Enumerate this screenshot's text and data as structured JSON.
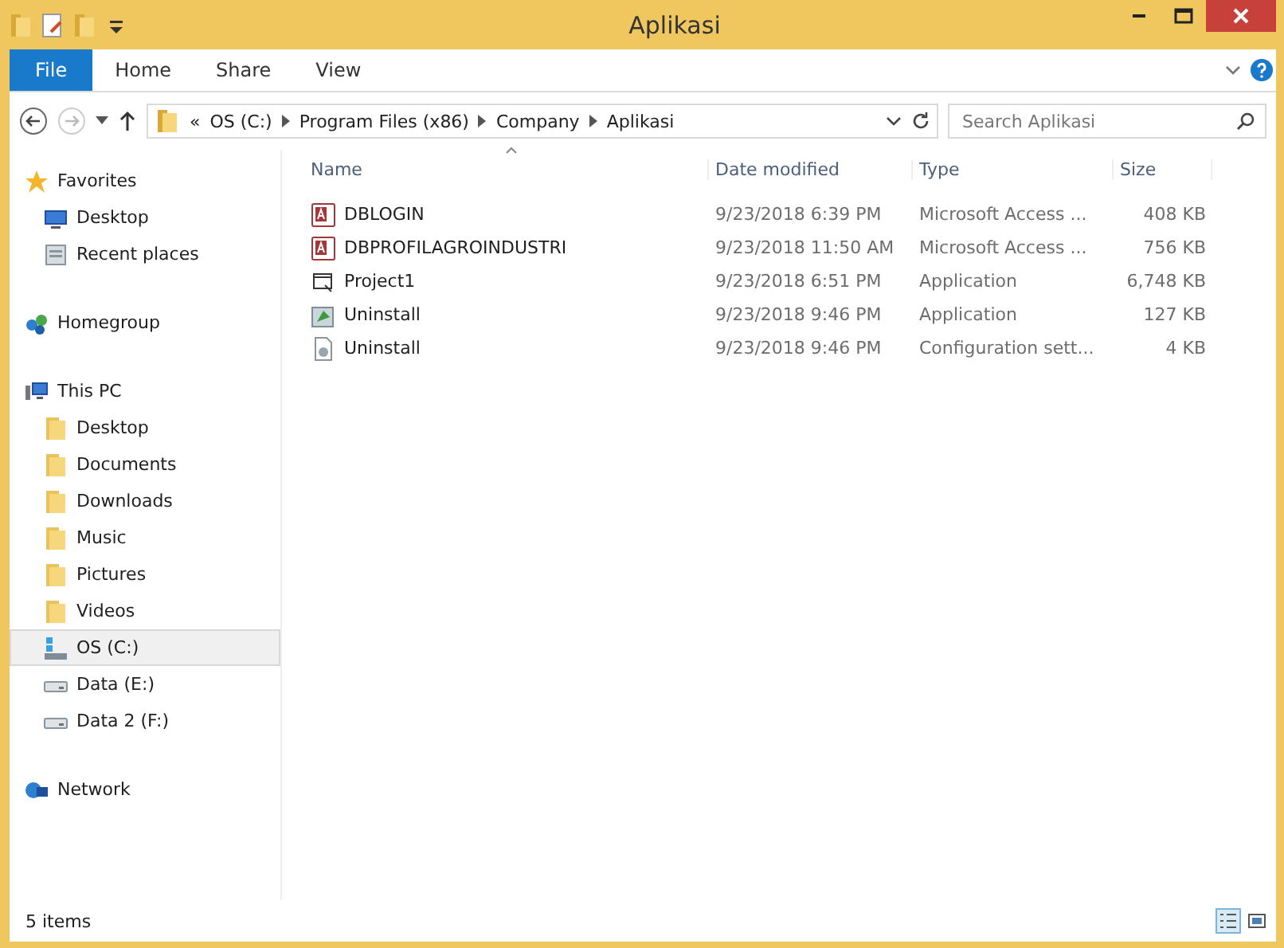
{
  "window": {
    "title": "Aplikasi"
  },
  "ribbon_tabs": [
    {
      "label": "File",
      "kind": "file"
    },
    {
      "label": "Home",
      "kind": "tab"
    },
    {
      "label": "Share",
      "kind": "tab"
    },
    {
      "label": "View",
      "kind": "tab"
    }
  ],
  "address_bar": {
    "overflow": "«",
    "path": [
      "OS (C:)",
      "Program Files (x86)",
      "Company",
      "Aplikasi"
    ]
  },
  "search": {
    "placeholder": "Search Aplikasi"
  },
  "sidebar": {
    "items": [
      {
        "label": "Favorites",
        "kind": "favorites",
        "selected": false,
        "children": [
          {
            "label": "Desktop",
            "kind": "desktop",
            "selected": false
          },
          {
            "label": "Recent places",
            "kind": "recent",
            "selected": false
          }
        ]
      },
      {
        "label": "Homegroup",
        "kind": "homegroup",
        "selected": false
      },
      {
        "label": "This PC",
        "kind": "computer",
        "selected": false,
        "children": [
          {
            "label": "Desktop",
            "kind": "folder",
            "selected": false
          },
          {
            "label": "Documents",
            "kind": "folder",
            "selected": false
          },
          {
            "label": "Downloads",
            "kind": "folder",
            "selected": false
          },
          {
            "label": "Music",
            "kind": "folder",
            "selected": false
          },
          {
            "label": "Pictures",
            "kind": "folder",
            "selected": false
          },
          {
            "label": "Videos",
            "kind": "folder",
            "selected": false
          },
          {
            "label": "OS (C:)",
            "kind": "system-drive",
            "selected": true
          },
          {
            "label": "Data (E:)",
            "kind": "drive",
            "selected": false
          },
          {
            "label": "Data 2 (F:)",
            "kind": "drive",
            "selected": false
          }
        ]
      },
      {
        "label": "Network",
        "kind": "network",
        "selected": false
      }
    ]
  },
  "table": {
    "columns": [
      "Name",
      "Date modified",
      "Type",
      "Size"
    ],
    "rows": [
      {
        "name": "DBLOGIN",
        "kind": "access",
        "date": "9/23/2018 6:39 PM",
        "type": "Microsoft Access ...",
        "size": "408 KB"
      },
      {
        "name": "DBPROFILAGROINDUSTRI",
        "kind": "access",
        "date": "9/23/2018 11:50 AM",
        "type": "Microsoft Access ...",
        "size": "756 KB"
      },
      {
        "name": "Project1",
        "kind": "app",
        "date": "9/23/2018 6:51 PM",
        "type": "Application",
        "size": "6,748 KB"
      },
      {
        "name": "Uninstall",
        "kind": "installer",
        "date": "9/23/2018 9:46 PM",
        "type": "Application",
        "size": "127 KB"
      },
      {
        "name": "Uninstall",
        "kind": "config",
        "date": "9/23/2018 9:46 PM",
        "type": "Configuration sett...",
        "size": "4 KB"
      }
    ]
  },
  "status_bar": {
    "text": "5 items"
  }
}
